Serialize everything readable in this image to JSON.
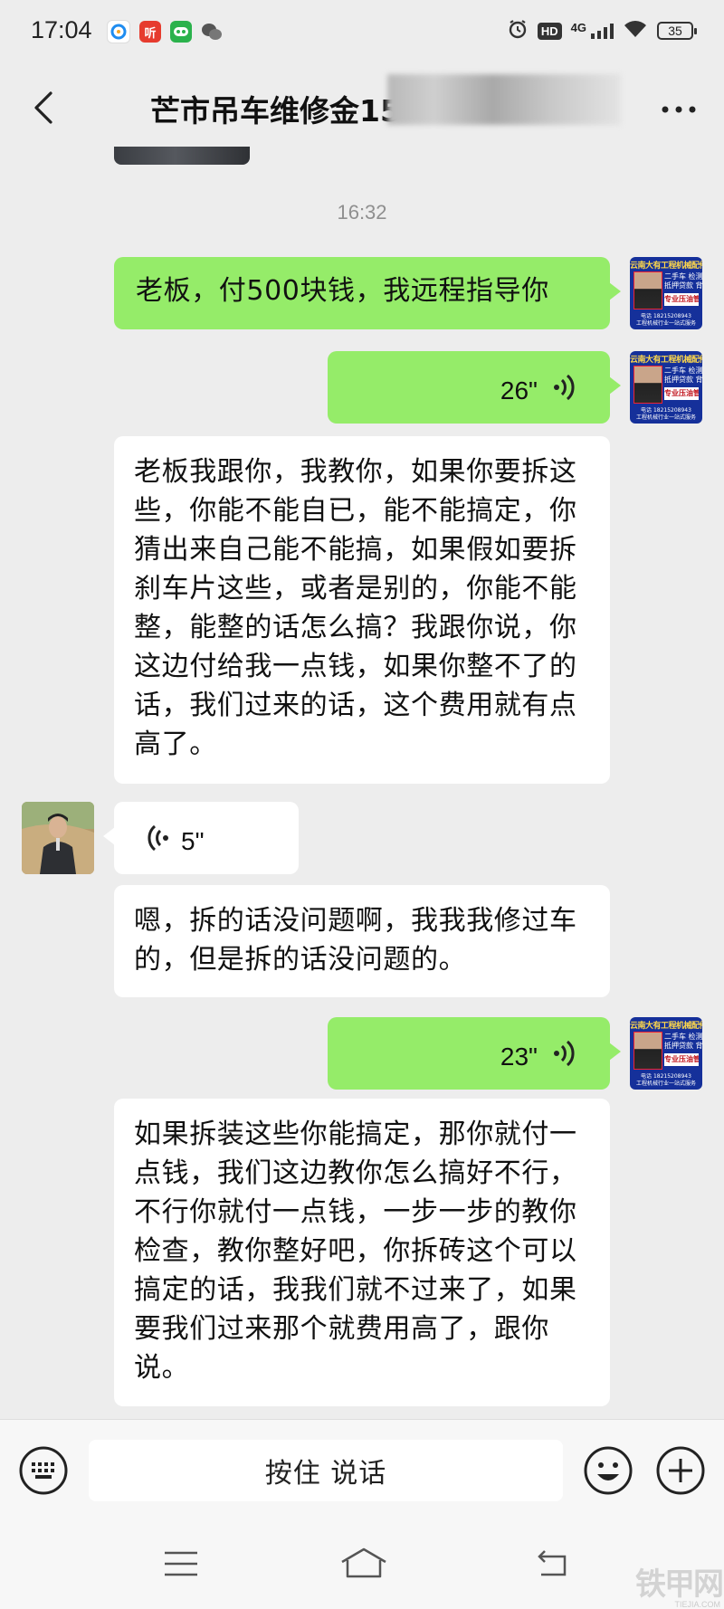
{
  "status_bar": {
    "time": "17:04",
    "network_label": "4G",
    "hd_label": "HD",
    "battery_level": "35"
  },
  "header": {
    "title": "芒市吊车维修金15"
  },
  "chat": {
    "timestamp": "16:32",
    "messages": [
      {
        "id": "m1",
        "sender": "me",
        "type": "text",
        "text": "老板，付500块钱，我远程指导你"
      },
      {
        "id": "m2",
        "sender": "me",
        "type": "voice",
        "duration": "26\""
      },
      {
        "id": "m3",
        "sender": "me",
        "type": "voice-transcript",
        "text": "老板我跟你，我教你，如果你要拆这些，你能不能自已，能不能搞定，你猜出来自己能不能搞，如果假如要拆刹车片这些，或者是别的，你能不能整，能整的话怎么搞？我跟你说，你这边付给我一点钱，如果你整不了的话，我们过来的话，这个费用就有点高了。"
      },
      {
        "id": "m4",
        "sender": "other",
        "type": "voice",
        "duration": "5\""
      },
      {
        "id": "m5",
        "sender": "other",
        "type": "voice-transcript",
        "text": "嗯，拆的话没问题啊，我我我修过车的，但是拆的话没问题的。"
      },
      {
        "id": "m6",
        "sender": "me",
        "type": "voice",
        "duration": "23\""
      },
      {
        "id": "m7",
        "sender": "me",
        "type": "voice-transcript",
        "text": "如果拆装这些你能搞定，那你就付一点钱，我们这边教你怎么搞好不行，不行你就付一点钱，一步一步的教你检查，教你整好吧，你拆砖这个可以搞定的话，我我们就不过来了，如果要我们过来那个就费用高了，跟你说。"
      }
    ],
    "my_avatar_banner": {
      "company": "云南大有工程机械配件",
      "line1": "二手车 检测",
      "line2": "抵押贷款 背售",
      "name": "专业压油管",
      "phone": "电话 18215208943",
      "slogan": "工程机械行业一站式服务"
    }
  },
  "input_bar": {
    "hold_to_talk_label": "按住 说话"
  },
  "watermark": {
    "text": "铁甲网",
    "sub": "TIEJIA.COM"
  },
  "colors": {
    "my_bubble": "#95ec69",
    "other_bubble": "#ffffff",
    "background": "#ededed"
  }
}
